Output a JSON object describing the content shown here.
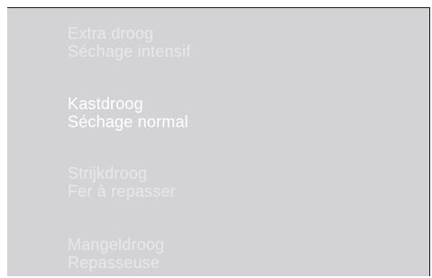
{
  "program_menu": {
    "items": [
      {
        "line1": "Extra droog",
        "line2": "Séchage intensif",
        "selected": false
      },
      {
        "line1": "Kastdroog",
        "line2": "Séchage normal",
        "selected": true
      },
      {
        "line1": "Strijkdroog",
        "line2": "Fer à repasser",
        "selected": false
      },
      {
        "line1": "Mangeldroog",
        "line2": "Repasseuse",
        "selected": false
      }
    ]
  },
  "colors": {
    "screen_background": "#d3d3d5",
    "inactive_text": "#e8e8e9",
    "active_text": "#ffffff"
  }
}
